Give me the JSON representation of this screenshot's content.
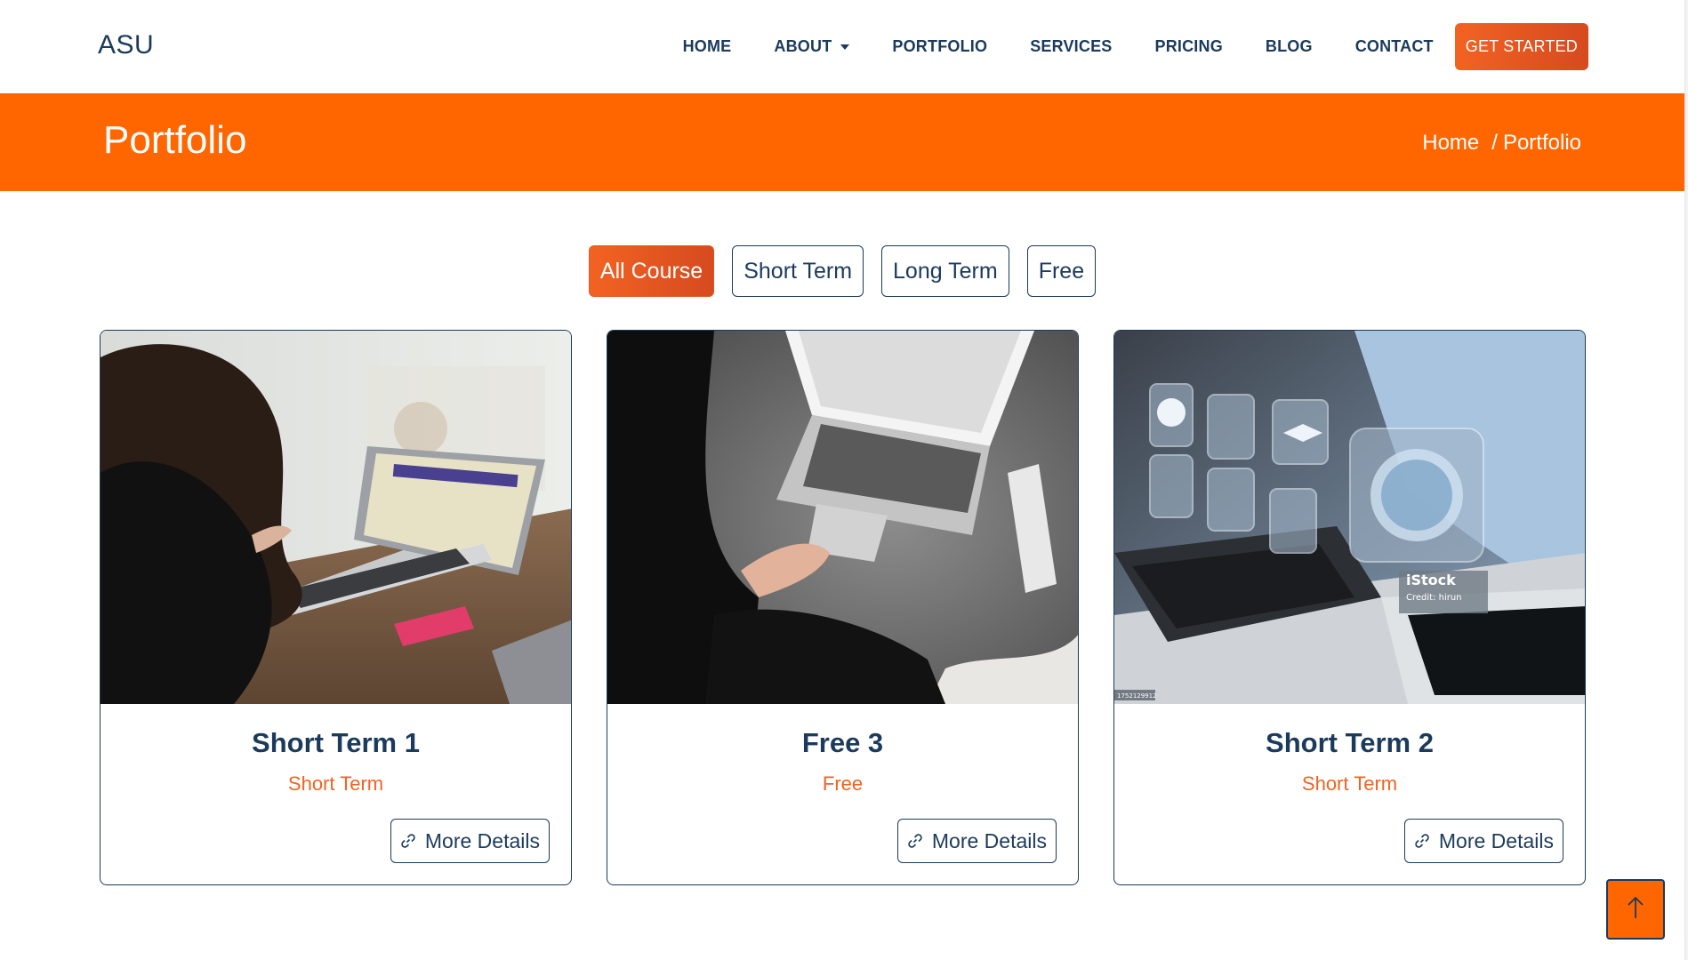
{
  "header": {
    "logo": "ASU",
    "nav": [
      {
        "label": "HOME"
      },
      {
        "label": "ABOUT"
      },
      {
        "label": "PORTFOLIO"
      },
      {
        "label": "SERVICES"
      },
      {
        "label": "PRICING"
      },
      {
        "label": "BLOG"
      },
      {
        "label": "CONTACT"
      }
    ],
    "cta_label": "GET STARTED"
  },
  "banner": {
    "title": "Portfolio",
    "breadcrumb": {
      "home": "Home",
      "separator": "/",
      "current": "Portfolio"
    }
  },
  "filters": [
    {
      "label": "All Course",
      "active": true
    },
    {
      "label": "Short Term",
      "active": false
    },
    {
      "label": "Long Term",
      "active": false
    },
    {
      "label": "Free",
      "active": false
    }
  ],
  "cards": [
    {
      "title": "Short Term 1",
      "category": "Short Term",
      "button": "More Details",
      "image": "girl-with-laptop-photo"
    },
    {
      "title": "Free 3",
      "category": "Free",
      "button": "More Details",
      "image": "laptop-on-rug-photo"
    },
    {
      "title": "Short Term 2",
      "category": "Short Term",
      "button": "More Details",
      "image": "online-learning-icons-photo",
      "image_watermark": {
        "brand": "iStock",
        "credit": "Credit: hirun",
        "stock_id": "1752129912"
      }
    }
  ],
  "colors": {
    "accent": "#ff6600",
    "navy": "#1b3a5c",
    "cta_gradient_end": "#d64a1f"
  },
  "icons": {
    "card_button": "link-icon",
    "to_top": "arrow-up-icon",
    "about_dropdown": "caret-down-icon"
  }
}
